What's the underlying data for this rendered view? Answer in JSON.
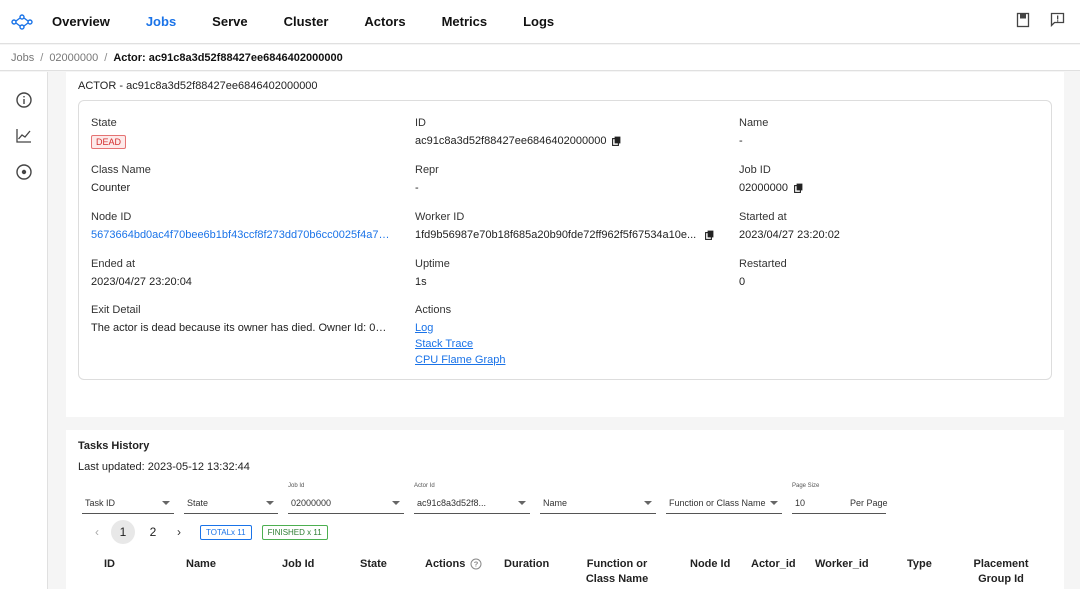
{
  "nav": {
    "items": [
      "Overview",
      "Jobs",
      "Serve",
      "Cluster",
      "Actors",
      "Metrics",
      "Logs"
    ],
    "active": "Jobs",
    "icons": [
      "book-icon",
      "feedback-icon"
    ]
  },
  "breadcrumb": [
    "Jobs",
    "02000000",
    "Actor: ac91c8a3d52f88427ee6846402000000"
  ],
  "sidebar": {
    "icons": [
      "info-icon",
      "chart-icon",
      "target-icon"
    ]
  },
  "actor": {
    "title": "ACTOR - ac91c8a3d52f88427ee6846402000000",
    "fields": {
      "state": {
        "label": "State",
        "value": "DEAD"
      },
      "id": {
        "label": "ID",
        "value": "ac91c8a3d52f88427ee6846402000000"
      },
      "name": {
        "label": "Name",
        "value": "-"
      },
      "class_name": {
        "label": "Class Name",
        "value": "Counter"
      },
      "repr": {
        "label": "Repr",
        "value": "-"
      },
      "job_id": {
        "label": "Job ID",
        "value": "02000000"
      },
      "node_id": {
        "label": "Node ID",
        "value": "5673664bd0ac4f70bee6b1bf43ccf8f273dd70b6cc0025f4a7a..."
      },
      "worker_id": {
        "label": "Worker ID",
        "value": "1fd9b56987e70b18f685a20b90fde72ff962f5f67534a10e..."
      },
      "started_at": {
        "label": "Started at",
        "value": "2023/04/27 23:20:02"
      },
      "ended_at": {
        "label": "Ended at",
        "value": "2023/04/27 23:20:04"
      },
      "uptime": {
        "label": "Uptime",
        "value": "1s"
      },
      "restarted": {
        "label": "Restarted",
        "value": "0"
      },
      "exit_detail": {
        "label": "Exit Detail",
        "value": "The actor is dead because its owner has died. Owner Id: 0200..."
      },
      "actions": {
        "label": "Actions",
        "links": [
          "Log",
          "Stack Trace",
          "CPU Flame Graph"
        ]
      }
    }
  },
  "tasks": {
    "title": "Tasks History",
    "updated": "Last updated: 2023-05-12 13:32:44",
    "filters": {
      "task_id": {
        "value": "Task ID"
      },
      "state": {
        "value": "State"
      },
      "job_id": {
        "label": "Job Id",
        "value": "02000000"
      },
      "actor_id": {
        "label": "Actor Id",
        "value": "ac91c8a3d52f8..."
      },
      "name": {
        "value": "Name"
      },
      "func": {
        "value": "Function or Class Name"
      },
      "page_size": {
        "label": "Page Size",
        "value": "10",
        "suffix": "Per Page"
      }
    },
    "pager": {
      "prev": "‹",
      "pages": [
        "1",
        "2"
      ],
      "next": "›",
      "current": "1"
    },
    "chips": {
      "total": "TOTALx 11",
      "finished": "FINISHED x 11"
    },
    "columns": [
      "ID",
      "Name",
      "Job Id",
      "State",
      "Actions",
      "Duration",
      "Function or Class Name",
      "Node Id",
      "Actor_id",
      "Worker_id",
      "Type",
      "Placement Group Id"
    ]
  },
  "colors": {
    "accent": "#1a73e8",
    "dead": "#d32f2f",
    "finished": "#2e7d32"
  }
}
